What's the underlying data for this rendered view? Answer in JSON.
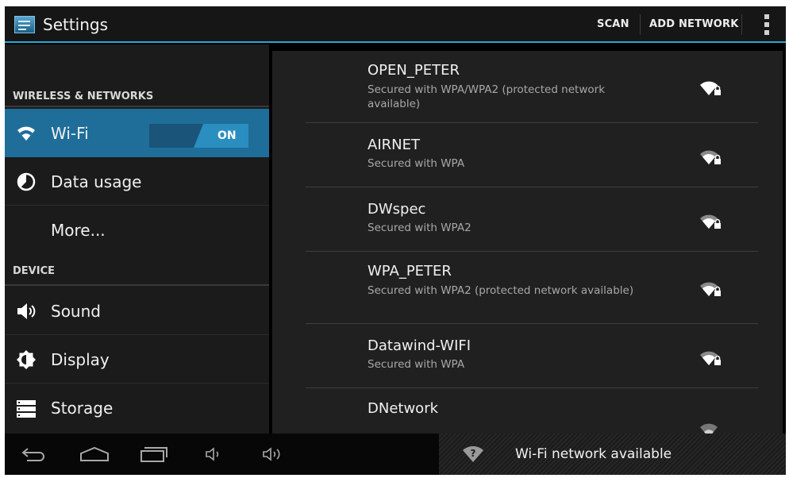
{
  "action_bar": {
    "title": "Settings",
    "scan_label": "SCAN",
    "add_network_label": "ADD NETWORK",
    "app_icon": "settings-app-icon",
    "overflow_icon": "overflow-menu-icon"
  },
  "sidebar": {
    "section_wireless": "WIRELESS & NETWORKS",
    "section_device": "DEVICE",
    "items": [
      {
        "label": "Wi-Fi",
        "icon": "wifi-icon",
        "selected": true
      },
      {
        "label": "Data usage",
        "icon": "data-usage-icon"
      },
      {
        "label": "More...",
        "icon": ""
      },
      {
        "label": "Sound",
        "icon": "speaker-icon"
      },
      {
        "label": "Display",
        "icon": "display-brightness-icon"
      },
      {
        "label": "Storage",
        "icon": "storage-icon"
      }
    ],
    "wifi_toggle_state": "ON"
  },
  "networks": [
    {
      "ssid": "OPEN_PETER",
      "security": "Secured with WPA/WPA2 (protected network available)",
      "icon": "wifi-locked-signal-icon"
    },
    {
      "ssid": "AIRNET",
      "security": "Secured with WPA",
      "icon": "wifi-locked-signal-icon"
    },
    {
      "ssid": "DWspec",
      "security": "Secured with WPA2",
      "icon": "wifi-locked-signal-icon"
    },
    {
      "ssid": "WPA_PETER",
      "security": "Secured with WPA2 (protected network available)",
      "icon": "wifi-locked-signal-icon"
    },
    {
      "ssid": "Datawind-WIFI",
      "security": "Secured with WPA",
      "icon": "wifi-locked-signal-icon"
    },
    {
      "ssid": "DNetwork",
      "security": "",
      "icon": "wifi-weak-signal-icon"
    }
  ],
  "navbar": {
    "buttons": [
      "back-icon",
      "home-icon",
      "recent-apps-icon",
      "volume-down-icon",
      "volume-up-icon"
    ],
    "notification_text": "Wi-Fi network available",
    "notification_icon": "wifi-question-icon"
  },
  "colors": {
    "accent": "#2aa6d6",
    "selected_row": "#1f6e9a",
    "toggle_on": "#2a8ec0",
    "background": "#1b1b1b"
  }
}
